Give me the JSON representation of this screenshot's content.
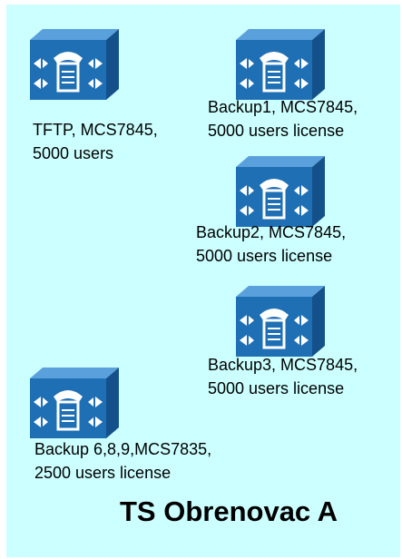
{
  "title": "TS Obrenovac A",
  "colors": {
    "panel_bg": "#ccffff",
    "icon_front": "#1f6fb5",
    "icon_top": "#5aa0dc",
    "icon_side": "#14508a"
  },
  "nodes": [
    {
      "icon": "call-manager-server-icon",
      "line1": "TFTP, MCS7845,",
      "line2": "5000 users"
    },
    {
      "icon": "call-manager-server-icon",
      "line1": "Backup1, MCS7845,",
      "line2": "5000 users license"
    },
    {
      "icon": "call-manager-server-icon",
      "line1": "Backup2, MCS7845,",
      "line2": "5000 users license"
    },
    {
      "icon": "call-manager-server-icon",
      "line1": "Backup3, MCS7845,",
      "line2": "5000 users license"
    },
    {
      "icon": "call-manager-server-icon",
      "line1": "Backup 6,8,9,MCS7835,",
      "line2": "2500 users license"
    }
  ]
}
